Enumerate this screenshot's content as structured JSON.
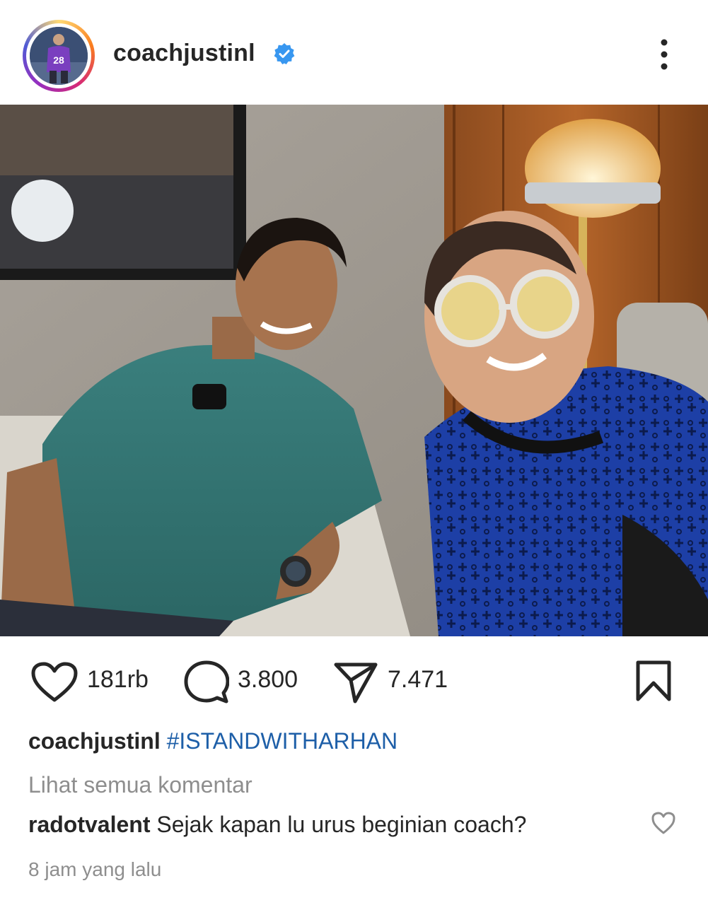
{
  "post": {
    "username": "coachjustinl",
    "avatar_jersey_number": "28",
    "verified": true
  },
  "actions": {
    "likes": "181rb",
    "comments": "3.800",
    "shares": "7.471"
  },
  "caption": {
    "username": "coachjustinl",
    "hashtag": "#ISTANDWITHARHAN"
  },
  "view_all_comments": "Lihat semua komentar",
  "top_comment": {
    "username": "radotvalent",
    "text": "Sejak kapan lu urus beginian coach?"
  },
  "timestamp": "8 jam yang lalu",
  "colors": {
    "verified_blue": "#3897f0",
    "hashtag_blue": "#1e5fa8",
    "muted_text": "#8e8e8e"
  }
}
